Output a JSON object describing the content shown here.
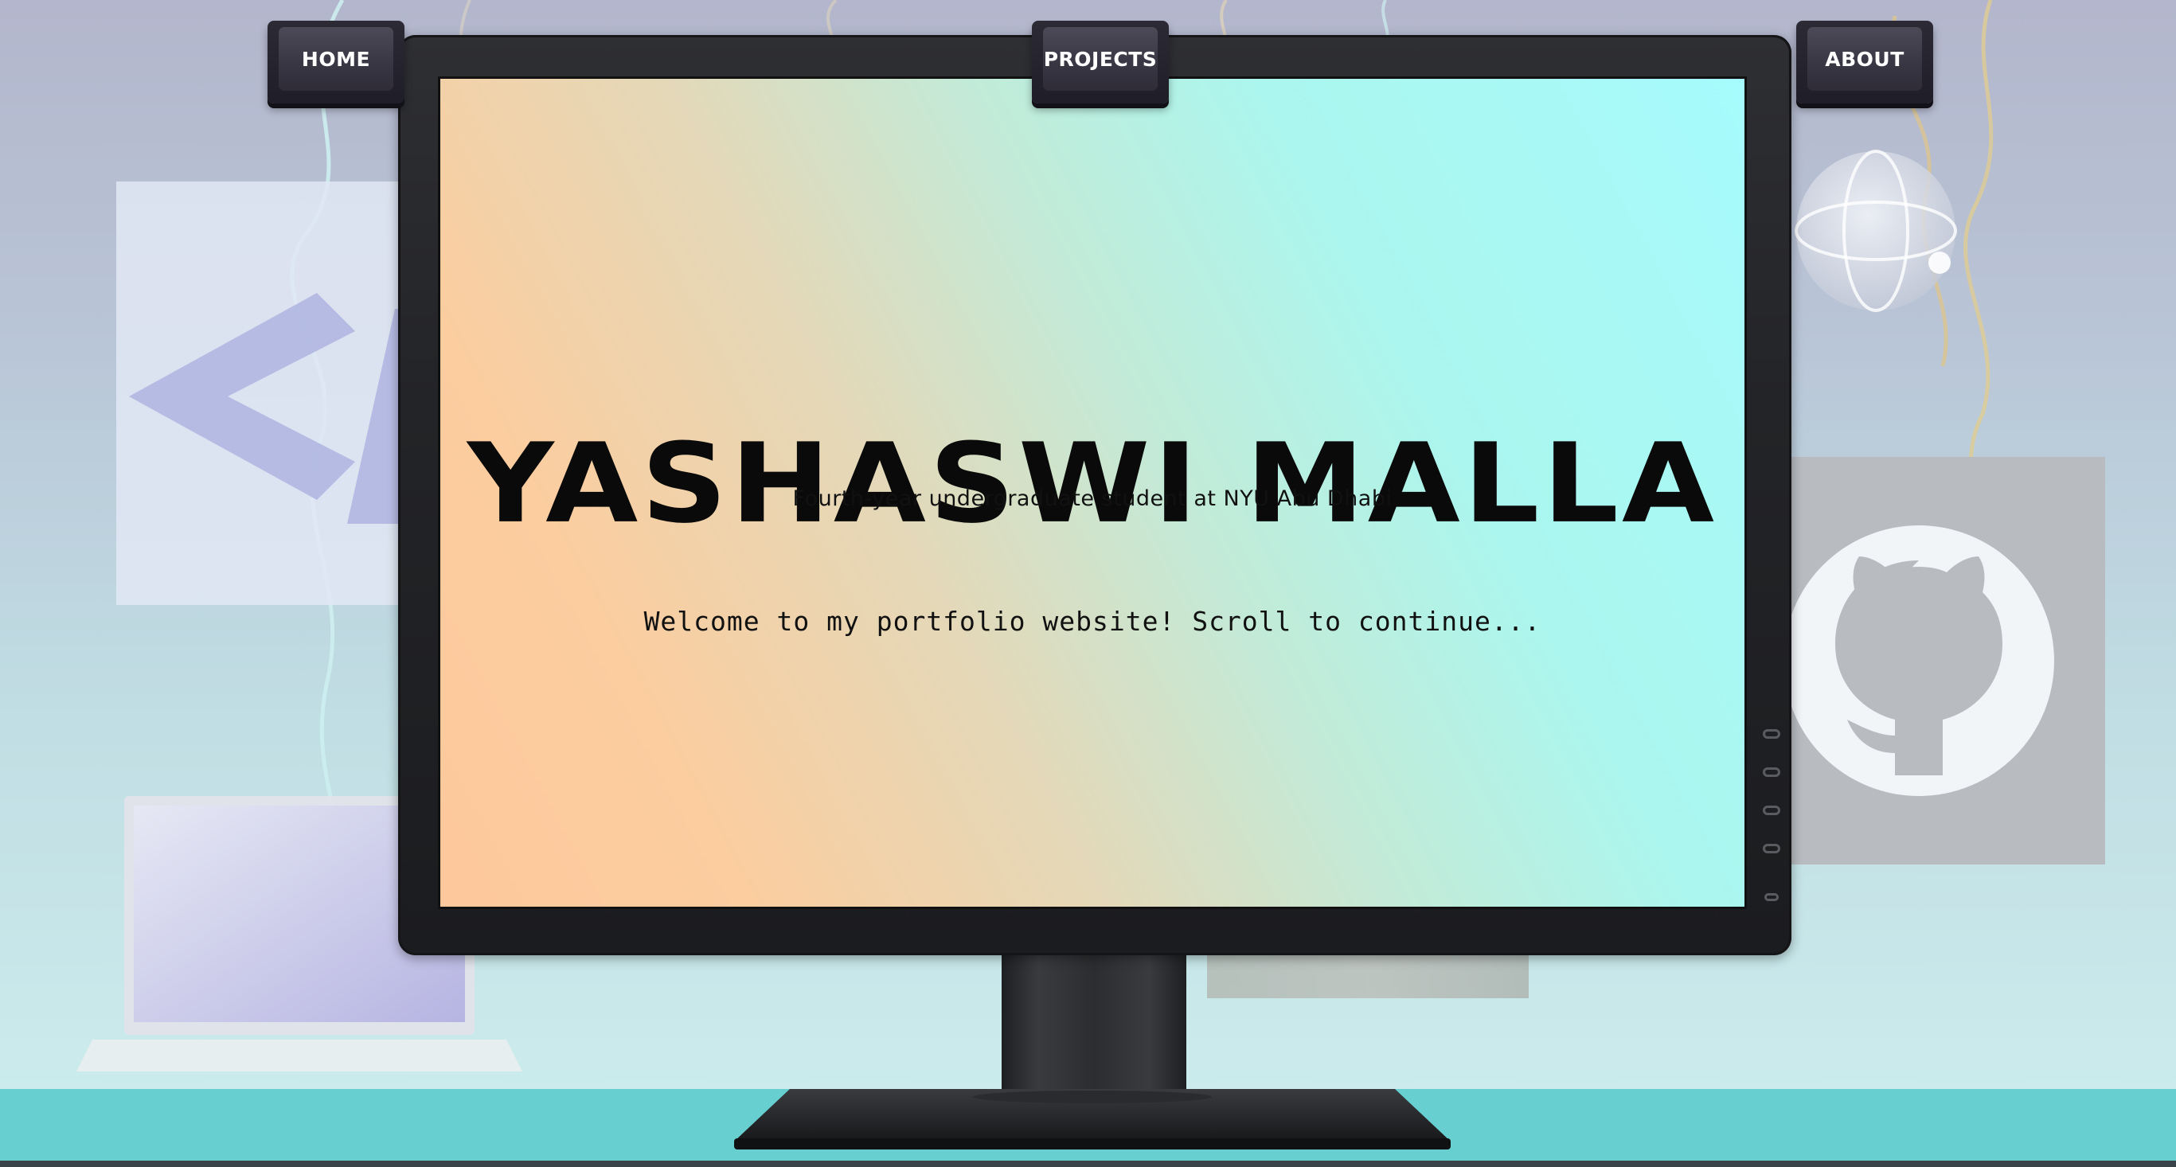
{
  "nav": {
    "home_label": "HOME",
    "projects_label": "PROJECTS",
    "about_label": "ABOUT"
  },
  "hero": {
    "name": "YASHASWI MALLA",
    "subtitle": "Fourth-year undergraduate student at NYU Abu Dhabi",
    "welcome": "Welcome to my portfolio website! Scroll to continue..."
  },
  "decor": {
    "left_tile_icon": "code-brackets-icon",
    "right_tile_icon": "github-icon",
    "globe_icon": "globe-icon",
    "laptop_icon": "laptop-icon"
  },
  "colors": {
    "screen_gradient_start": "#fdc89c",
    "screen_gradient_end": "#a6fbfc",
    "desk": "#67cfd0",
    "keycap": "#3a3745"
  }
}
